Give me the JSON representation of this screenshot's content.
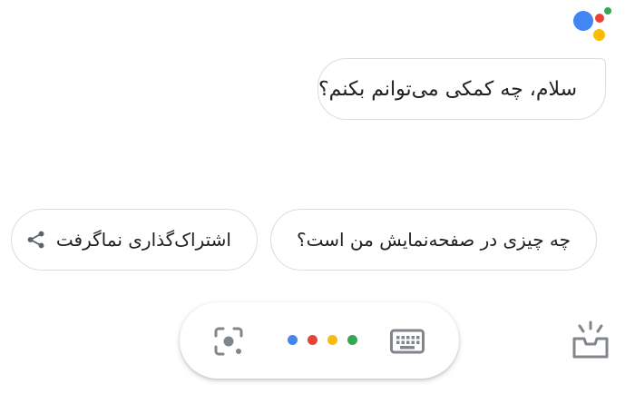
{
  "assistant": {
    "logo_icon": "google-assistant-logo",
    "colors": {
      "blue": "#4285f4",
      "red": "#ea4335",
      "yellow": "#fbbc05",
      "green": "#34a853",
      "icon_gray": "#80868b"
    }
  },
  "conversation": {
    "greeting": "سلام، چه کمکی می‌توانم بکنم؟"
  },
  "suggestions": [
    {
      "label": "چه چیزی در صفحه‌نمایش من است؟"
    },
    {
      "label": "اشتراک‌گذاری نماگرفت",
      "icon": "share-icon"
    }
  ],
  "input_bar": {
    "left_icon": "lens-icon",
    "center_icon": "assistant-dots",
    "right_icon": "keyboard-icon"
  },
  "snapshot_icon": "snapshot-icon"
}
